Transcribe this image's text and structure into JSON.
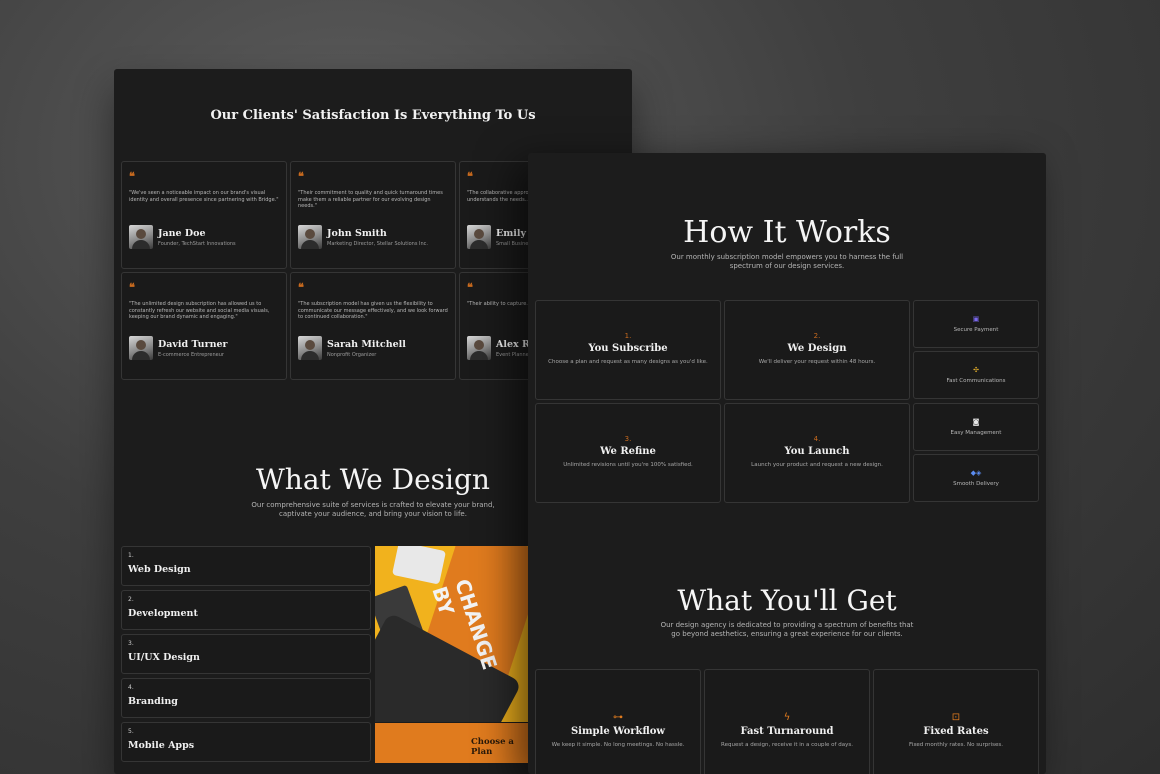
{
  "testimonials": {
    "title": "Our Clients' Satisfaction Is Everything To Us",
    "quote_icon": "quote-icon",
    "items": [
      {
        "quote": "\"We've seen a noticeable impact on our brand's visual identity and overall presence since partnering with Bridge.\"",
        "name": "Jane Doe",
        "role": "Founder, TechStart Innovations"
      },
      {
        "quote": "\"Their commitment to quality and quick turnaround times make them a reliable partner for our evolving design needs.\"",
        "name": "John Smith",
        "role": "Marketing Director, Stellar Solutions Inc."
      },
      {
        "quote": "\"The collaborative approach makes us feel heard and understands the needs...\"",
        "name": "Emily",
        "role": "Small Business"
      },
      {
        "quote": "\"The unlimited design subscription has allowed us to constantly refresh our website and social media visuals, keeping our brand dynamic and engaging.\"",
        "name": "David Turner",
        "role": "E-commerce Entrepreneur"
      },
      {
        "quote": "\"The subscription model has given us the flexibility to communicate our message effectively, and we look forward to continued collaboration.\"",
        "name": "Sarah Mitchell",
        "role": "Nonprofit Organizer"
      },
      {
        "quote": "\"Their ability to capture... their designs help... success.\"",
        "name": "Alex R",
        "role": "Event Planner"
      }
    ]
  },
  "what_we_design": {
    "title": "What We Design",
    "subtitle": "Our comprehensive suite of services is crafted to elevate your brand, captivate your audience, and bring your vision to life.",
    "services": [
      {
        "num": "1.",
        "label": "Web Design"
      },
      {
        "num": "2.",
        "label": "Development"
      },
      {
        "num": "3.",
        "label": "UI/UX Design"
      },
      {
        "num": "4.",
        "label": "Branding"
      },
      {
        "num": "5.",
        "label": "Mobile Apps"
      }
    ],
    "photo_text": "CHANGE BY",
    "cta_label": "Choose a Plan"
  },
  "how_it_works": {
    "title": "How It Works",
    "subtitle": "Our monthly subscription model empowers you to harness the full spectrum of our design services.",
    "steps": [
      {
        "num": "1.",
        "title": "You Subscribe",
        "desc": "Choose a plan and request as many designs as you'd like."
      },
      {
        "num": "2.",
        "title": "We Design",
        "desc": "We'll deliver your request within 48 hours."
      },
      {
        "num": "3.",
        "title": "We Refine",
        "desc": "Unlimited revisions until you're 100% satisfied."
      },
      {
        "num": "4.",
        "title": "You Launch",
        "desc": "Launch your product and request a new design."
      }
    ],
    "features": [
      {
        "icon": "stripe-icon",
        "glyph": "▣",
        "label": "Secure Payment"
      },
      {
        "icon": "slack-icon",
        "glyph": "✣",
        "label": "Fast Communications"
      },
      {
        "icon": "notion-icon",
        "glyph": "◙",
        "label": "Easy Management"
      },
      {
        "icon": "figma-framer-icon",
        "glyph": "◆◈",
        "label": "Smooth Delivery"
      }
    ]
  },
  "what_youll_get": {
    "title": "What You'll Get",
    "subtitle": "Our design agency is dedicated to providing a spectrum of benefits that go beyond aesthetics, ensuring a great experience for our clients.",
    "benefits": [
      {
        "icon": "workflow-icon",
        "glyph": "⊶",
        "title": "Simple Workflow",
        "desc": "We keep it simple. No long meetings. No hassle."
      },
      {
        "icon": "lightning-icon",
        "glyph": "ϟ",
        "title": "Fast Turnaround",
        "desc": "Request a design, receive it in a couple of days."
      },
      {
        "icon": "price-tag-icon",
        "glyph": "⊡",
        "title": "Fixed Rates",
        "desc": "Fixed monthly rates. No surprises."
      }
    ]
  },
  "colors": {
    "accent": "#e07b1e",
    "background": "#1c1c1c",
    "card_border": "#353535"
  }
}
